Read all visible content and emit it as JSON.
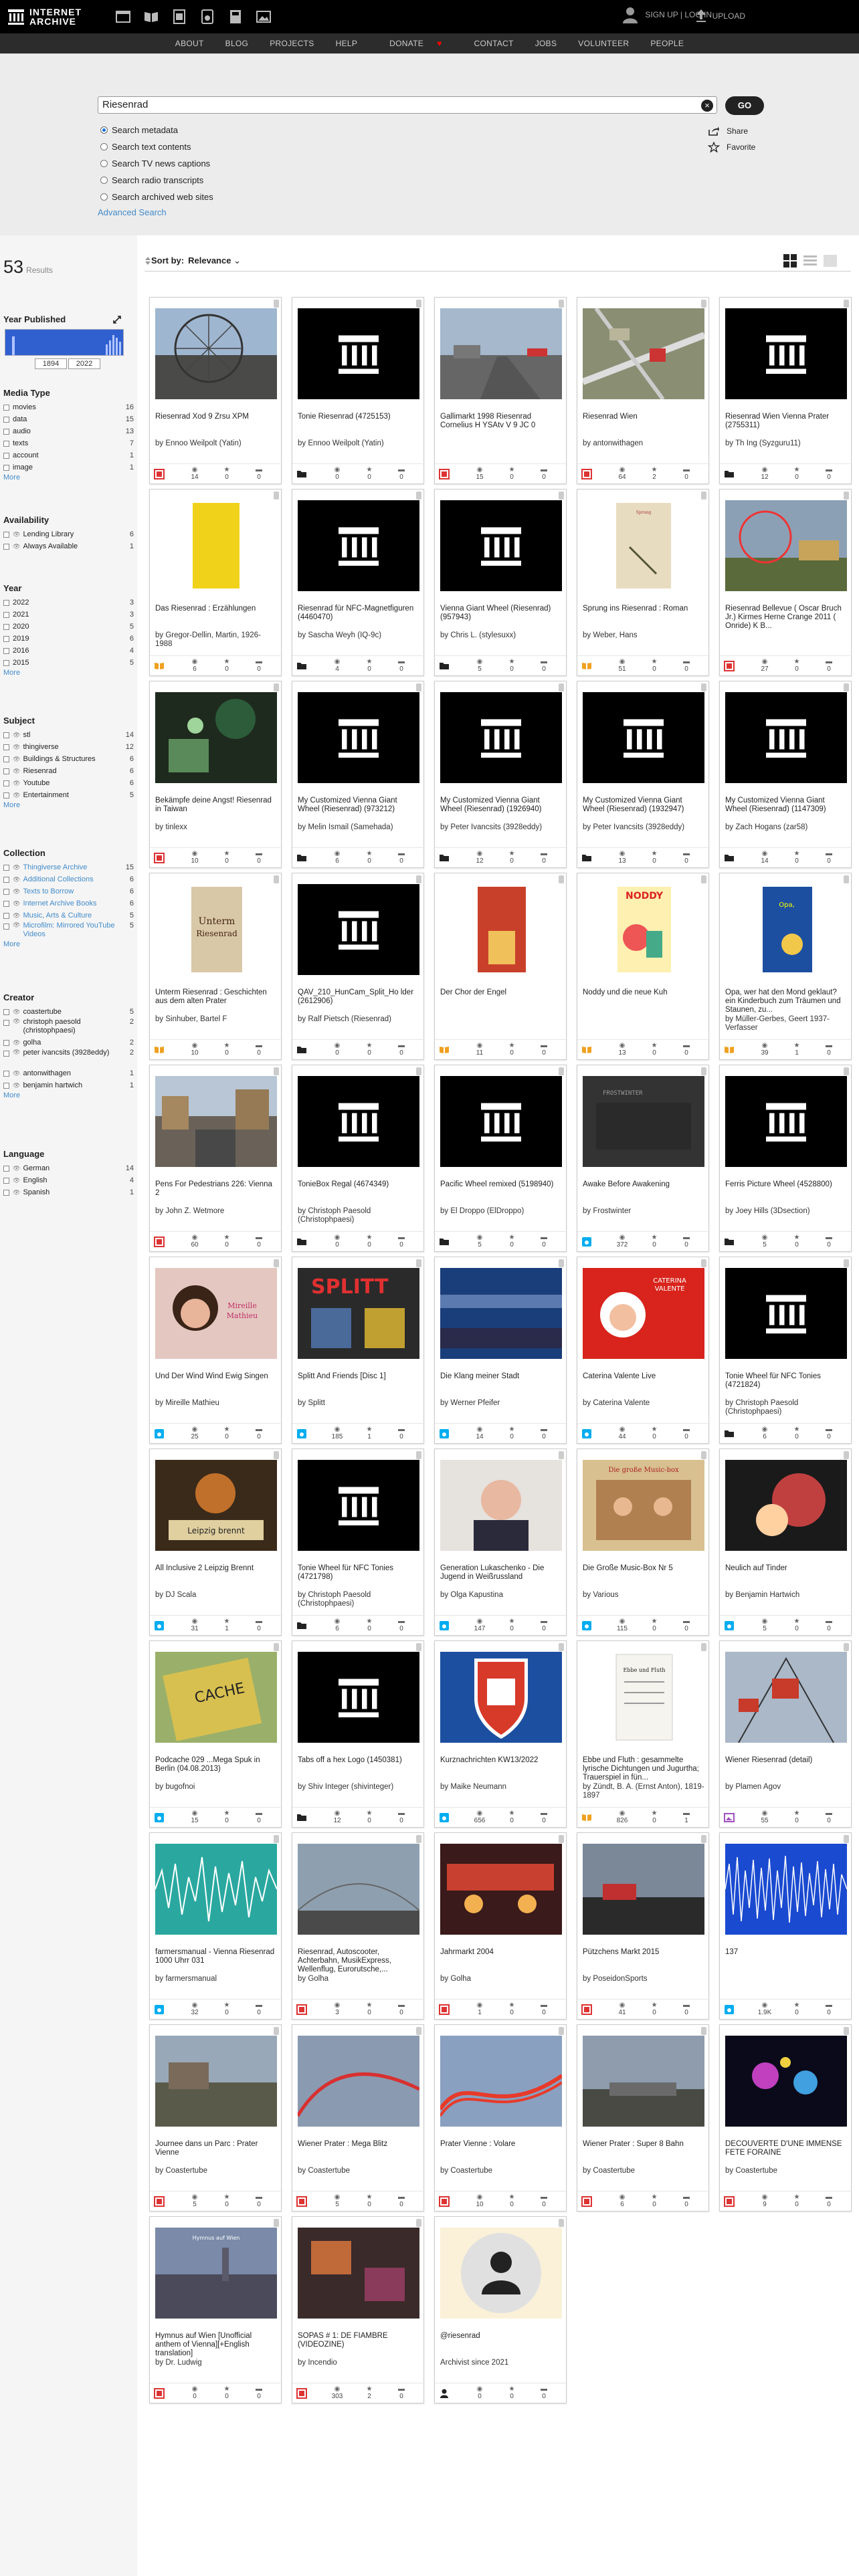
{
  "header": {
    "logo_line1": "INTERNET",
    "logo_line2": "ARCHIVE",
    "user_links": "SIGN UP | LOG IN",
    "upload_label": "UPLOAD"
  },
  "nav": [
    "ABOUT",
    "BLOG",
    "PROJECTS",
    "HELP",
    "DONATE",
    "CONTACT",
    "JOBS",
    "VOLUNTEER",
    "PEOPLE"
  ],
  "search": {
    "query": "Riesenrad",
    "go_label": "GO",
    "options": [
      "Search metadata",
      "Search text contents",
      "Search TV news captions",
      "Search radio transcripts",
      "Search archived web sites"
    ],
    "advanced": "Advanced Search",
    "share": "Share",
    "favorite": "Favorite"
  },
  "results": {
    "count": "53",
    "label": "Results",
    "sort_label": "Sort by:",
    "sort_value": "Relevance"
  },
  "facets": {
    "year_published": "Year Published",
    "year_from": "1894",
    "year_to": "2022",
    "media_type": {
      "title": "Media Type",
      "items": [
        [
          "movies",
          "16"
        ],
        [
          "data",
          "15"
        ],
        [
          "audio",
          "13"
        ],
        [
          "texts",
          "7"
        ],
        [
          "account",
          "1"
        ],
        [
          "image",
          "1"
        ]
      ],
      "more": "More"
    },
    "availability": {
      "title": "Availability",
      "items": [
        [
          "Lending Library",
          "6"
        ],
        [
          "Always Available",
          "1"
        ]
      ]
    },
    "year": {
      "title": "Year",
      "items": [
        [
          "2022",
          "3"
        ],
        [
          "2021",
          "3"
        ],
        [
          "2020",
          "5"
        ],
        [
          "2019",
          "6"
        ],
        [
          "2016",
          "4"
        ],
        [
          "2015",
          "5"
        ]
      ],
      "more": "More"
    },
    "subject": {
      "title": "Subject",
      "items": [
        [
          "stl",
          "14"
        ],
        [
          "thingiverse",
          "12"
        ],
        [
          "Buildings & Structures",
          "6"
        ],
        [
          "Riesenrad",
          "6"
        ],
        [
          "Youtube",
          "6"
        ],
        [
          "Entertainment",
          "5"
        ]
      ],
      "more": "More"
    },
    "collection": {
      "title": "Collection",
      "items": [
        [
          "Thingiverse Archive",
          "15"
        ],
        [
          "Additional Collections",
          "6"
        ],
        [
          "Texts to Borrow",
          "6"
        ],
        [
          "Internet Archive Books",
          "6"
        ],
        [
          "Music, Arts & Culture",
          "5"
        ],
        [
          "Microfilm: Mirrored YouTube Videos",
          "5"
        ]
      ],
      "more": "More"
    },
    "creator": {
      "title": "Creator",
      "items": [
        [
          "coastertube",
          "5"
        ],
        [
          "christoph paesold (christophpaesi)",
          "2"
        ],
        [
          "golha",
          "2"
        ],
        [
          "peter ivancsits (3928eddy)",
          "2"
        ],
        [
          "antonwithagen",
          "1"
        ],
        [
          "benjamin hartwich",
          "1"
        ]
      ],
      "more": "More"
    },
    "language": {
      "title": "Language",
      "items": [
        [
          "German",
          "14"
        ],
        [
          "English",
          "4"
        ],
        [
          "Spanish",
          "1"
        ]
      ]
    }
  },
  "tiles": [
    {
      "title": "Riesenrad Xod 9 Zrsu XPM",
      "by": "by Ennoo Weilpolt (Yatin)",
      "m": "film",
      "s": [
        "14",
        "0",
        "0"
      ],
      "th": "ferris"
    },
    {
      "title": "Tonie Riesenrad (4725153)",
      "by": "by Ennoo Weilpolt (Yatin)",
      "m": "folder",
      "s": [
        "0",
        "0",
        "0"
      ],
      "th": "ia"
    },
    {
      "title": "Gallimarkt 1998 Riesenrad Cornelius H YSAtv V 9 JC 0",
      "by": "",
      "m": "film",
      "s": [
        "15",
        "0",
        "0"
      ],
      "th": "road"
    },
    {
      "title": "Riesenrad Wien",
      "by": "by antonwithagen",
      "m": "film",
      "s": [
        "64",
        "2",
        "0"
      ],
      "th": "aerial"
    },
    {
      "title": "Riesenrad Wien Vienna Prater (2755311)",
      "by": "by Th Ing (Syzguru11)",
      "m": "folder",
      "s": [
        "12",
        "0",
        "0"
      ],
      "th": "ia"
    },
    {
      "title": "Das Riesenrad : Erzählungen",
      "by": "by Gregor-Dellin, Martin, 1926-1988",
      "m": "book",
      "s": [
        "6",
        "0",
        "0"
      ],
      "th": "yellowbook"
    },
    {
      "title": "Riesenrad für NFC-Magnetfiguren (4460470)",
      "by": "by Sascha Weyh (IQ-9c)",
      "m": "folder",
      "s": [
        "4",
        "0",
        "0"
      ],
      "th": "ia"
    },
    {
      "title": "Vienna Giant Wheel (Riesenrad) (957943)",
      "by": "by Chris L. (stylesuxx)",
      "m": "folder",
      "s": [
        "5",
        "0",
        "0"
      ],
      "th": "ia"
    },
    {
      "title": "Sprung ins Riesenrad : Roman",
      "by": "by Weber, Hans",
      "m": "book",
      "s": [
        "51",
        "0",
        "0"
      ],
      "th": "tanbook"
    },
    {
      "title": "Riesenrad Bellevue ( Oscar Bruch Jr.) Kirmes Herne Crange 2011 ( Onride) K B...",
      "by": "",
      "m": "film",
      "s": [
        "27",
        "0",
        "0"
      ],
      "th": "fair"
    },
    {
      "title": "Bekämpfe deine Angst! Riesenrad in Taiwan",
      "by": "by tinlexx",
      "m": "film",
      "s": [
        "10",
        "0",
        "0"
      ],
      "th": "night"
    },
    {
      "title": "My Customized Vienna Giant Wheel (Riesenrad) (973212)",
      "by": "by Melin Ismail (Samehada)",
      "m": "folder",
      "s": [
        "6",
        "0",
        "0"
      ],
      "th": "ia"
    },
    {
      "title": "My Customized Vienna Giant Wheel (Riesenrad) (1926940)",
      "by": "by Peter Ivancsits (3928eddy)",
      "m": "folder",
      "s": [
        "12",
        "0",
        "0"
      ],
      "th": "ia"
    },
    {
      "title": "My Customized Vienna Giant Wheel (Riesenrad) (1932947)",
      "by": "by Peter Ivancsits (3928eddy)",
      "m": "folder",
      "s": [
        "13",
        "0",
        "0"
      ],
      "th": "ia"
    },
    {
      "title": "My Customized Vienna Giant Wheel (Riesenrad) (1147309)",
      "by": "by Zach Hogans (zar58)",
      "m": "folder",
      "s": [
        "14",
        "0",
        "0"
      ],
      "th": "ia"
    },
    {
      "title": "Unterm Riesenrad : Geschichten aus dem alten Prater",
      "by": "by Sinhuber, Bartel F",
      "m": "book",
      "s": [
        "10",
        "0",
        "0"
      ],
      "th": "unterm"
    },
    {
      "title": "QAV_210_HunCam_Split_Ho lder (2612906)",
      "by": "by Ralf Pietsch (Riesenrad)",
      "m": "folder",
      "s": [
        "0",
        "0",
        "0"
      ],
      "th": "ia"
    },
    {
      "title": "Der Chor der Engel",
      "by": "",
      "m": "book",
      "s": [
        "11",
        "0",
        "0"
      ],
      "th": "redbook"
    },
    {
      "title": "Noddy und die neue Kuh",
      "by": "",
      "m": "book",
      "s": [
        "13",
        "0",
        "0"
      ],
      "th": "noddy"
    },
    {
      "title": "Opa, wer hat den Mond geklaut? ein Kinderbuch zum Träumen und Staunen, zu...",
      "by": "by Müller-Gerbes, Geert 1937- Verfasser",
      "m": "book",
      "s": [
        "39",
        "1",
        "0"
      ],
      "th": "opa"
    },
    {
      "title": "Pens For Pedestrians 226: Vienna 2",
      "by": "by John Z. Wetmore",
      "m": "film",
      "s": [
        "60",
        "0",
        "0"
      ],
      "th": "street"
    },
    {
      "title": "TonieBox Regal (4674349)",
      "by": "by Christoph Paesold (Christophpaesi)",
      "m": "folder",
      "s": [
        "0",
        "0",
        "0"
      ],
      "th": "ia"
    },
    {
      "title": "Pacific Wheel remixed (5198940)",
      "by": "by El Droppo (ElDroppo)",
      "m": "folder",
      "s": [
        "5",
        "0",
        "0"
      ],
      "th": "ia"
    },
    {
      "title": "Awake Before Awakening",
      "by": "by Frostwinter",
      "m": "audio",
      "s": [
        "372",
        "0",
        "0"
      ],
      "th": "dark"
    },
    {
      "title": "Ferris Picture Wheel (4528800)",
      "by": "by Joey Hills (3Dsection)",
      "m": "folder",
      "s": [
        "5",
        "0",
        "0"
      ],
      "th": "ia"
    },
    {
      "title": "Und Der Wind Wind Ewig Singen",
      "by": "by Mireille Mathieu",
      "m": "audio",
      "s": [
        "25",
        "0",
        "0"
      ],
      "th": "mathieu"
    },
    {
      "title": "Splitt And Friends [Disc 1]",
      "by": "by Splitt",
      "m": "audio",
      "s": [
        "185",
        "1",
        "0"
      ],
      "th": "splitt"
    },
    {
      "title": "Die Klang meiner Stadt",
      "by": "by Werner Pfeifer",
      "m": "audio",
      "s": [
        "14",
        "0",
        "0"
      ],
      "th": "klang"
    },
    {
      "title": "Caterina Valente Live",
      "by": "by Caterina Valente",
      "m": "audio",
      "s": [
        "44",
        "0",
        "0"
      ],
      "th": "valente"
    },
    {
      "title": "Tonie Wheel für NFC Tonies (4721824)",
      "by": "by Christoph Paesold (Christophpaesi)",
      "m": "folder",
      "s": [
        "6",
        "0",
        "0"
      ],
      "th": "ia"
    },
    {
      "title": "All Inclusive 2 Leipzig Brennt",
      "by": "by DJ Scala",
      "m": "audio",
      "s": [
        "31",
        "1",
        "0"
      ],
      "th": "leipzig"
    },
    {
      "title": "Tonie Wheel für NFC Tonies (4721798)",
      "by": "by Christoph Paesold (Christophpaesi)",
      "m": "folder",
      "s": [
        "6",
        "0",
        "0"
      ],
      "th": "ia"
    },
    {
      "title": "Generation Lukaschenko - Die Jugend in Weißrussland",
      "by": "by Olga Kapustina",
      "m": "audio",
      "s": [
        "147",
        "0",
        "0"
      ],
      "th": "portrait"
    },
    {
      "title": "Die Große Music-Box Nr 5",
      "by": "by Various",
      "m": "audio",
      "s": [
        "115",
        "0",
        "0"
      ],
      "th": "musicbox"
    },
    {
      "title": "Neulich auf Tinder",
      "by": "by Benjamin Hartwich",
      "m": "audio",
      "s": [
        "5",
        "0",
        "0"
      ],
      "th": "tinder"
    },
    {
      "title": "Podcache 029 ...Mega Spuk in Berlin (04.08.2013)",
      "by": "by bugofnoi",
      "m": "audio",
      "s": [
        "15",
        "0",
        "0"
      ],
      "th": "cache"
    },
    {
      "title": "Tabs off a hex Logo (1450381)",
      "by": "by Shiv Integer (shivinteger)",
      "m": "folder",
      "s": [
        "12",
        "0",
        "0"
      ],
      "th": "ia"
    },
    {
      "title": "Kurznachrichten KW13/2022",
      "by": "by Maike Neumann",
      "m": "audio",
      "s": [
        "656",
        "0",
        "0"
      ],
      "th": "shield"
    },
    {
      "title": "Ebbe und Fluth : gesammelte lyrische Dichtungen und Jugurtha; Trauerspiel in fün...",
      "by": "by Zündt, B. A. (Ernst Anton), 1819-1897",
      "m": "book",
      "s": [
        "826",
        "0",
        "1"
      ],
      "th": "oldbook"
    },
    {
      "title": "Wiener Riesenrad (detail)",
      "by": "by Plamen Agov",
      "m": "image",
      "s": [
        "55",
        "0",
        "0"
      ],
      "th": "detail"
    },
    {
      "title": "farmersmanual - Vienna Riesenrad 1000 Uhrr 031",
      "by": "by farmersmanual",
      "m": "audio",
      "s": [
        "32",
        "0",
        "0"
      ],
      "th": "wave"
    },
    {
      "title": "Riesenrad, Autoscooter, Achterbahn, MusikExpress, Wellenflug, Eurorutsche,...",
      "by": "by Golha",
      "m": "film",
      "s": [
        "3",
        "0",
        "0"
      ],
      "th": "sky"
    },
    {
      "title": "Jahrmarkt 2004",
      "by": "by Golha",
      "m": "film",
      "s": [
        "1",
        "0",
        "0"
      ],
      "th": "jahrmarkt"
    },
    {
      "title": "Pützchens Markt 2015",
      "by": "by PoseidonSports",
      "m": "film",
      "s": [
        "41",
        "0",
        "0"
      ],
      "th": "pmarkt"
    },
    {
      "title": "137",
      "by": "",
      "m": "audio",
      "s": [
        "1.9K",
        "0",
        "0"
      ],
      "th": "bluewave"
    },
    {
      "title": "Journee dans un Parc : Prater Vienne",
      "by": "by Coastertube",
      "m": "film",
      "s": [
        "5",
        "0",
        "0"
      ],
      "th": "parc"
    },
    {
      "title": "Wiener Prater : Mega Blitz",
      "by": "by Coastertube",
      "m": "film",
      "s": [
        "5",
        "0",
        "0"
      ],
      "th": "blitz"
    },
    {
      "title": "Prater Vienne : Volare",
      "by": "by Coastertube",
      "m": "film",
      "s": [
        "10",
        "0",
        "0"
      ],
      "th": "volare"
    },
    {
      "title": "Wiener Prater : Super 8 Bahn",
      "by": "by Coastertube",
      "m": "film",
      "s": [
        "6",
        "0",
        "0"
      ],
      "th": "super8"
    },
    {
      "title": "DECOUVERTE D'UNE IMMENSE FETE FORAINE",
      "by": "by Coastertube",
      "m": "film",
      "s": [
        "9",
        "0",
        "0"
      ],
      "th": "fete"
    },
    {
      "title": "Hymnus auf Wien [Unofficial anthem of Vienna][+English translation]",
      "by": "by Dr. Ludwig",
      "m": "film",
      "s": [
        "0",
        "0",
        "0"
      ],
      "th": "hymnus"
    },
    {
      "title": "SOPAS # 1: DE FIAMBRE (VIDEOZINE)",
      "by": "by Incendio",
      "m": "film",
      "s": [
        "303",
        "2",
        "0"
      ],
      "th": "sopas"
    },
    {
      "title": "@riesenrad",
      "by": "Archivist since 2021",
      "m": "account",
      "s": [
        "0",
        "0",
        "0"
      ],
      "th": "account"
    }
  ]
}
